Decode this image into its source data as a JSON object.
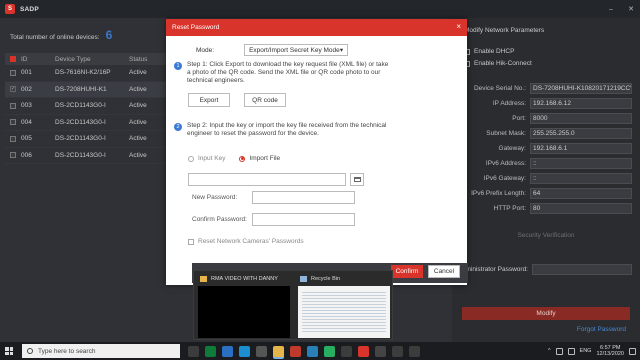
{
  "window": {
    "title": "SADP"
  },
  "device_list": {
    "online_label": "Total number of online devices:",
    "online_count": "6",
    "columns": [
      "ID",
      "Device Type",
      "Status"
    ],
    "rows": [
      {
        "id": "001",
        "type": "DS-7616NI-K2/16P",
        "status": "Active"
      },
      {
        "id": "002",
        "type": "DS-7208HUHI-K1",
        "status": "Active"
      },
      {
        "id": "003",
        "type": "DS-2CD1143G0-I",
        "status": "Active"
      },
      {
        "id": "004",
        "type": "DS-2CD1143G0-I",
        "status": "Active"
      },
      {
        "id": "005",
        "type": "DS-2CD1143G0-I",
        "status": "Active"
      },
      {
        "id": "006",
        "type": "DS-2CD1143G0-I",
        "status": "Active"
      }
    ]
  },
  "network_panel": {
    "title": "Modify Network Parameters",
    "enable_dhcp": "Enable DHCP",
    "enable_hik_connect": "Enable Hik-Connect",
    "fields": [
      {
        "label": "Device Serial No.:",
        "value": "DS-7208HUHI-K10820171219CCW"
      },
      {
        "label": "IP Address:",
        "value": "192.168.6.12"
      },
      {
        "label": "Port:",
        "value": "8000"
      },
      {
        "label": "Subnet Mask:",
        "value": "255.255.255.0"
      },
      {
        "label": "Gateway:",
        "value": "192.168.6.1"
      },
      {
        "label": "IPv6 Address:",
        "value": "::"
      },
      {
        "label": "IPv6 Gateway:",
        "value": "::"
      },
      {
        "label": "IPv6 Prefix Length:",
        "value": "64"
      },
      {
        "label": "HTTP Port:",
        "value": "80"
      }
    ],
    "security_verification": "Security Verification",
    "admin_password_label": "Administrator Password:",
    "modify_label": "Modify",
    "forgot_label": "Forgot Password"
  },
  "reset_dialog": {
    "title": "Reset Password",
    "close": "×",
    "mode_label": "Mode:",
    "mode_value": "Export/Import Secret Key Mode",
    "step1_num": "1",
    "step1_text": "Step 1: Click Export to download the key request file (XML file) or take a photo of the QR code. Send the XML file or QR code photo to our technical engineers.",
    "export_label": "Export",
    "qr_label": "QR code",
    "step2_num": "2",
    "step2_text": "Step 2: Input the key or import the key file received from the technical engineer to reset the password for the device.",
    "input_key_label": "Input Key",
    "import_file_label": "Import File",
    "new_password_label": "New Password:",
    "confirm_password_label": "Confirm Password:",
    "reset_cameras_label": "Reset Network Cameras' Passwords",
    "confirm_label": "Confirm",
    "cancel_label": "Cancel"
  },
  "taskbar_previews": [
    {
      "title": "RMA VIDEO WITH DANNY"
    },
    {
      "title": "Recycle Bin"
    }
  ],
  "taskbar": {
    "search_placeholder": "Type here to search",
    "language": "ENG",
    "time": "6:57 PM",
    "date": "12/13/2020"
  },
  "colors": {
    "accent": "#d9342b",
    "step_blue": "#3a7bd5",
    "link": "#4a8ad0"
  }
}
